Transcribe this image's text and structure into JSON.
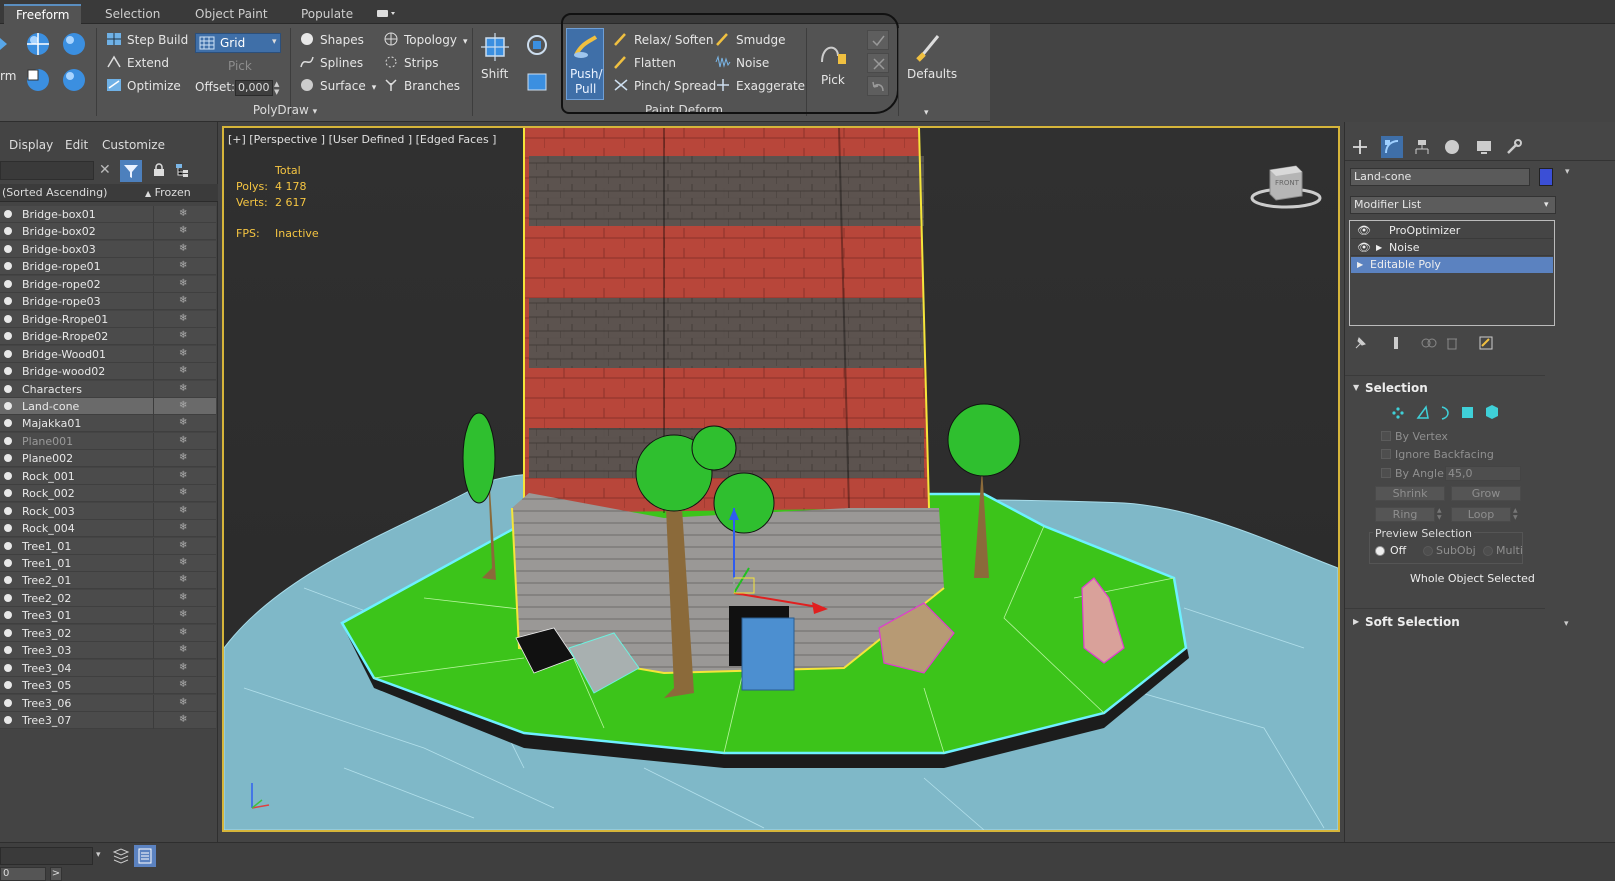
{
  "ribbon": {
    "tabs": [
      "Freeform",
      "Selection",
      "Object Paint",
      "Populate"
    ],
    "polydraw": {
      "left_cut_label": "rm",
      "step_build": "Step Build",
      "extend": "Extend",
      "optimize": "Optimize",
      "grid_value": "Grid",
      "pick": "Pick",
      "offset_label": "Offset:",
      "offset_value": "0,000",
      "shapes": "Shapes",
      "splines": "Splines",
      "surface": "Surface",
      "topology": "Topology",
      "strips": "Strips",
      "branches": "Branches",
      "group_label": "PolyDraw"
    },
    "paint_deform": {
      "shift": "Shift",
      "push_pull_line1": "Push/",
      "push_pull_line2": "Pull",
      "relax_soften": "Relax/ Soften",
      "flatten": "Flatten",
      "pinch_spread": "Pinch/ Spread",
      "smudge": "Smudge",
      "noise": "Noise",
      "exaggerate": "Exaggerate",
      "pick": "Pick",
      "group_label": "Paint Deform"
    },
    "defaults": "Defaults"
  },
  "explorer": {
    "menu": [
      "Display",
      "Edit",
      "Customize"
    ],
    "sort_label": "(Sorted Ascending)",
    "frozen_header": "Frozen",
    "objects": [
      {
        "name": "Bridge-box01"
      },
      {
        "name": "Bridge-box02"
      },
      {
        "name": "Bridge-box03"
      },
      {
        "name": "Bridge-rope01"
      },
      {
        "name": "Bridge-rope02"
      },
      {
        "name": "Bridge-rope03"
      },
      {
        "name": "Bridge-Rrope01"
      },
      {
        "name": "Bridge-Rrope02"
      },
      {
        "name": "Bridge-Wood01"
      },
      {
        "name": "Bridge-wood02"
      },
      {
        "name": "Characters"
      },
      {
        "name": "Land-cone",
        "selected": true
      },
      {
        "name": "Majakka01"
      },
      {
        "name": "Plane001",
        "dim": true
      },
      {
        "name": "Plane002"
      },
      {
        "name": "Rock_001"
      },
      {
        "name": "Rock_002"
      },
      {
        "name": "Rock_003"
      },
      {
        "name": "Rock_004"
      },
      {
        "name": "Tree1_01"
      },
      {
        "name": "Tree1_01"
      },
      {
        "name": "Tree2_01"
      },
      {
        "name": "Tree2_02"
      },
      {
        "name": "Tree3_01"
      },
      {
        "name": "Tree3_02"
      },
      {
        "name": "Tree3_03"
      },
      {
        "name": "Tree3_04"
      },
      {
        "name": "Tree3_05"
      },
      {
        "name": "Tree3_06"
      },
      {
        "name": "Tree3_07"
      }
    ]
  },
  "viewport": {
    "label": "[+] [Perspective ] [User Defined ] [Edged Faces ]",
    "stats_total": "Total",
    "polys_label": "Polys:",
    "polys_value": "4 178",
    "verts_label": "Verts:",
    "verts_value": "2 617",
    "fps_label": "FPS:",
    "fps_value": "Inactive",
    "viewcube_label": "FRONT"
  },
  "command_panel": {
    "object_name": "Land-cone",
    "object_color": "#3b4fd6",
    "modifier_list": "Modifier List",
    "stack": [
      "ProOptimizer",
      "Noise",
      "Editable Poly"
    ],
    "selection": {
      "title": "Selection",
      "by_vertex": "By Vertex",
      "ignore_backfacing": "Ignore Backfacing",
      "by_angle": "By Angle:",
      "angle_value": "45,0",
      "shrink": "Shrink",
      "grow": "Grow",
      "ring": "Ring",
      "loop": "Loop",
      "preview_title": "Preview Selection",
      "off": "Off",
      "subobj": "SubObj",
      "multi": "Multi",
      "whole_object": "Whole Object Selected"
    },
    "soft_selection": "Soft Selection"
  },
  "bottom": {
    "frame_value": "0",
    "arrow": ">"
  },
  "colors": {
    "accent_blue": "#5b82c0",
    "viewport_border": "#d6b53a",
    "stats": "#f5c542"
  }
}
